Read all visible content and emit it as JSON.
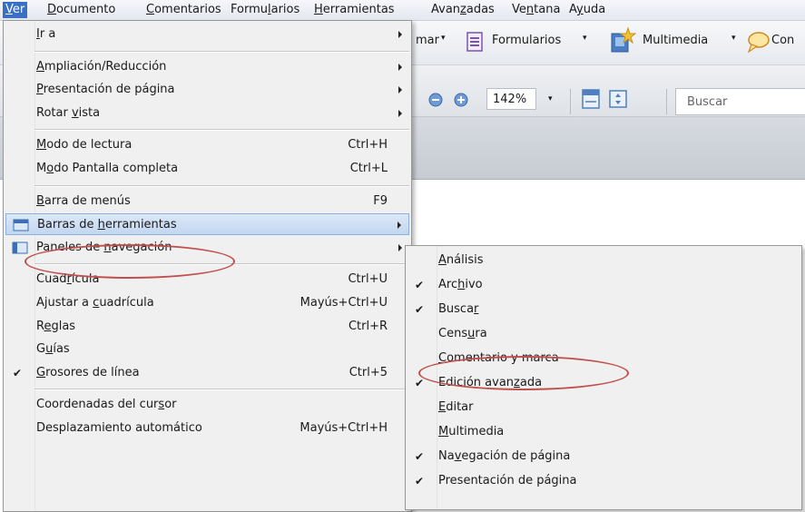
{
  "menubar": {
    "items": [
      {
        "label": "Ver",
        "key": "V",
        "rest": "er"
      },
      {
        "label": "Documento",
        "key": "D",
        "rest": "ocumento"
      },
      {
        "label": "Comentarios",
        "key": "C",
        "rest": "omentarios"
      },
      {
        "label": "Formularios",
        "pre": "Formu",
        "key": "l",
        "rest": "arios"
      },
      {
        "label": "Herramientas",
        "key": "H",
        "rest": "erramientas"
      },
      {
        "label": "Avanzadas",
        "pre": "Avan",
        "key": "z",
        "rest": "adas"
      },
      {
        "label": "Ventana",
        "pre": "Ve",
        "key": "n",
        "rest": "tana"
      },
      {
        "label": "Ayuda",
        "pre": "A",
        "key": "y",
        "rest": "uda"
      }
    ]
  },
  "toolbar": {
    "firmar_partial": "mar",
    "formularios": "Formularios",
    "multimedia": "Multimedia",
    "comentar_partial": "Con",
    "zoom": "142%",
    "search_placeholder": "Buscar"
  },
  "view_menu": {
    "items": [
      {
        "pre": "",
        "key": "I",
        "post": "r a",
        "arrow": true
      },
      {
        "sep": true
      },
      {
        "pre": "",
        "key": "A",
        "post": "mpliación/Reducción",
        "arrow": true
      },
      {
        "pre": "",
        "key": "P",
        "post": "resentación de página",
        "arrow": true
      },
      {
        "pre": "Rotar ",
        "key": "v",
        "post": "ista",
        "arrow": true
      },
      {
        "sep": true
      },
      {
        "pre": "",
        "key": "M",
        "post": "odo de lectura",
        "shortcut": "Ctrl+H"
      },
      {
        "pre": "M",
        "key": "o",
        "post": "do Pantalla completa",
        "shortcut": "Ctrl+L"
      },
      {
        "sep": true
      },
      {
        "pre": "",
        "key": "B",
        "post": "arra de menús",
        "shortcut": "F9"
      },
      {
        "pre": "Barras de ",
        "key": "h",
        "post": "erramientas",
        "arrow": true,
        "highlight": true,
        "icon": "toolbar-icon"
      },
      {
        "pre": "Paneles de ",
        "key": "n",
        "post": "avegación",
        "arrow": true,
        "icon": "navigation-panel-icon"
      },
      {
        "sep": true
      },
      {
        "pre": "Cuad",
        "key": "r",
        "post": "ícula",
        "shortcut": "Ctrl+U"
      },
      {
        "pre": "Ajustar a ",
        "key": "c",
        "post": "uadrícula",
        "shortcut": "Mayús+Ctrl+U"
      },
      {
        "pre": "R",
        "key": "e",
        "post": "glas",
        "shortcut": "Ctrl+R"
      },
      {
        "pre": "G",
        "key": "u",
        "post": "ías"
      },
      {
        "pre": "",
        "key": "G",
        "post": "rosores de línea",
        "shortcut": "Ctrl+5",
        "checked": true
      },
      {
        "sep": true
      },
      {
        "pre": "Coordenadas del cur",
        "key": "s",
        "post": "or"
      },
      {
        "pre": "Desplazamiento automático",
        "key": "",
        "post": "",
        "shortcut": "Mayús+Ctrl+H"
      }
    ]
  },
  "toolbars_submenu": {
    "items": [
      {
        "pre": "",
        "key": "A",
        "post": "nálisis"
      },
      {
        "pre": "Arc",
        "key": "h",
        "post": "ivo",
        "checked": true
      },
      {
        "pre": "Busca",
        "key": "r",
        "post": "",
        "checked": true
      },
      {
        "pre": "Cens",
        "key": "u",
        "post": "ra"
      },
      {
        "pre": "",
        "key": "C",
        "post": "omentario y marca"
      },
      {
        "pre": "Edición avan",
        "key": "z",
        "post": "ada",
        "checked": true
      },
      {
        "pre": "",
        "key": "E",
        "post": "ditar"
      },
      {
        "pre": "",
        "key": "M",
        "post": "ultimedia"
      },
      {
        "pre": "Na",
        "key": "v",
        "post": "egación de página",
        "checked": true
      },
      {
        "pre": "Presentación de página",
        "key": "",
        "post": "",
        "checked": true
      }
    ]
  },
  "colors": {
    "menubar_active": "#3a6fc4",
    "annotation": "#c0504d",
    "highlight": "#c2d6f0"
  },
  "glyphs": {
    "check": "✔"
  }
}
